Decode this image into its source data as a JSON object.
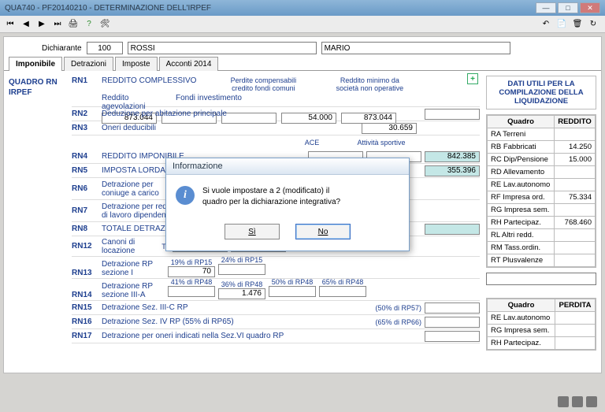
{
  "window": {
    "title": "QUA740 - PF20140210 - DETERMINAZIONE DELL'IRPEF"
  },
  "declarant": {
    "label": "Dichiarante",
    "code": "100",
    "surname": "ROSSI",
    "name": "MARIO"
  },
  "tabs": [
    "Imponibile",
    "Detrazioni",
    "Imposte",
    "Acconti 2014"
  ],
  "left_title_line1": "QUADRO RN",
  "left_title_line2": "IRPEF",
  "rn1": {
    "code": "RN1",
    "title": "REDDITO COMPLESSIVO",
    "col1": "Reddito agevolazioni",
    "col2": "Fondi investimento",
    "col3": "Perdite compensabili credito fondi comuni",
    "col4": "Reddito minimo da società non operative",
    "v1": "873.044",
    "v4": "54.000",
    "v5": "873.044"
  },
  "rn2": {
    "code": "RN2",
    "title": "Deduzione per abitazione principale"
  },
  "rn3": {
    "code": "RN3",
    "title": "Oneri deducibili",
    "v": "30.659"
  },
  "ace_label": "ACE",
  "att_sport_label": "Attività sportive",
  "rn4": {
    "code": "RN4",
    "title": "REDDITO IMPONIBILE",
    "v": "842.385"
  },
  "rn5": {
    "code": "RN5",
    "title": "IMPOSTA LORDA",
    "v": "355.396"
  },
  "rn6": {
    "code": "RN6",
    "line1": "Detrazione per",
    "line2": "coniuge a carico"
  },
  "rn7": {
    "code": "RN7",
    "line1": "Detrazione per redditi",
    "line2": "di lavoro dipendente"
  },
  "rn8": {
    "code": "RN8",
    "title": "TOTALE DETRAZIONI"
  },
  "rn12": {
    "code": "RN12",
    "line1": "Canoni di",
    "line2": "locazione",
    "to_label": "To"
  },
  "rn13": {
    "code": "RN13",
    "line1": "Detrazione RP",
    "line2": "sezione I",
    "c1": "19% di RP15",
    "c2": "24% di RP15",
    "v": "70"
  },
  "rn14": {
    "code": "RN14",
    "line1": "Detrazione RP",
    "line2": "sezione III-A",
    "c1": "41% di RP48",
    "c2": "36% di RP48",
    "c3": "50% di RP48",
    "c4": "65% di RP48",
    "v2": "1.476"
  },
  "rn15": {
    "code": "RN15",
    "title": "Detrazione Sez. III-C RP",
    "pct": "(50% di RP57)"
  },
  "rn16": {
    "code": "RN16",
    "title": "Detrazione Sez. IV RP   (55% di RP65)",
    "pct": "(65% di RP66)"
  },
  "rn17": {
    "code": "RN17",
    "title": "Detrazione per oneri indicati nella Sez.VI quadro RP"
  },
  "right_panel_title": "DATI UTILI PER LA COMPILAZIONE DELLA LIQUIDAZIONE",
  "reddito_table": {
    "hdr1": "Quadro",
    "hdr2": "REDDITO",
    "rows": [
      {
        "q": "RA Terreni",
        "v": ""
      },
      {
        "q": "RB Fabbricati",
        "v": "14.250"
      },
      {
        "q": "RC Dip/Pensione",
        "v": "15.000"
      },
      {
        "q": "RD Allevamento",
        "v": ""
      },
      {
        "q": "RE Lav.autonomo",
        "v": ""
      },
      {
        "q": "RF Impresa ord.",
        "v": "75.334"
      },
      {
        "q": "RG Impresa sem.",
        "v": ""
      },
      {
        "q": "RH Partecipaz.",
        "v": "768.460"
      },
      {
        "q": "RL Altri redd.",
        "v": ""
      },
      {
        "q": "RM Tass.ordin.",
        "v": ""
      },
      {
        "q": "RT Plusvalenze",
        "v": ""
      }
    ]
  },
  "perdita_table": {
    "hdr1": "Quadro",
    "hdr2": "PERDITA",
    "rows": [
      {
        "q": "RE Lav.autonomo"
      },
      {
        "q": "RG Impresa sem."
      },
      {
        "q": "RH Partecipaz."
      }
    ]
  },
  "dialog": {
    "title": "Informazione",
    "msg1": "Si vuole impostare a 2 (modificato) il",
    "msg2": "quadro per la dichiarazione integrativa?",
    "yes": "Sì",
    "no": "No"
  }
}
